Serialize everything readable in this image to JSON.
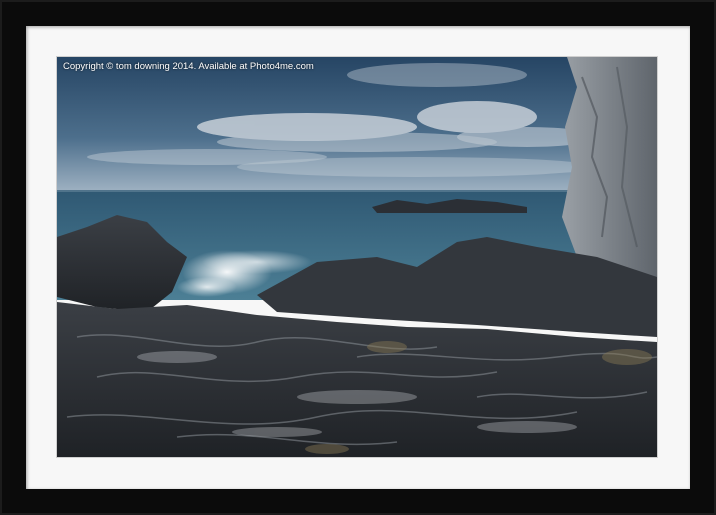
{
  "image": {
    "description_name": "rocky-coast-photo",
    "watermark": "Copyright © tom downing 2014. Available at Photo4me.com"
  },
  "colors": {
    "frame": "#0b0b0b",
    "mount": "#f7f7f7",
    "sky_top": "#2e4d6c",
    "sea": "#3f6a82",
    "rock": "#2e3238",
    "cliff": "#8a8f96"
  }
}
